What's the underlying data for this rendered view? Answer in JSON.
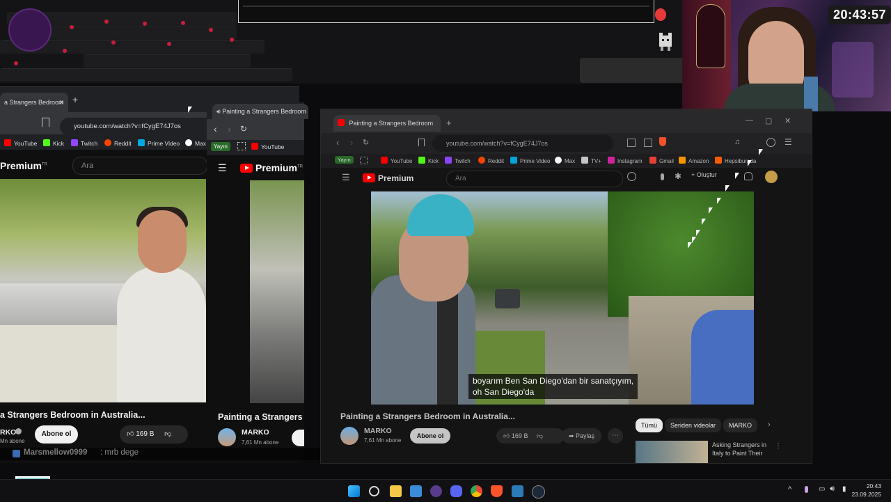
{
  "overlay": {
    "clock": "20:43:57",
    "chat_user": "Marsmellow0999",
    "chat_message": ": mrb dege"
  },
  "window_left": {
    "tab_title": "a Strangers Bedroom",
    "new_tab": "+",
    "url": "youtube.com/watch?v=fCygE74J7os",
    "bookmarks": [
      "YouTube",
      "Kick",
      "Twitch",
      "Reddit",
      "Prime Video",
      "Max"
    ],
    "logo": "Premium",
    "logo_sup": "TR",
    "search_placeholder": "Ara",
    "video_title": "a Strangers Bedroom in Australia...",
    "channel": "RKO",
    "subs": "Mn abone",
    "subscribe": "Abone ol",
    "likes": "169 B"
  },
  "window_middle": {
    "tab_title": "Painting a Strangers Bedroom",
    "badge": "Yayın",
    "bookmark": "YouTube",
    "logo": "Premium",
    "logo_sup": "TR",
    "video_title": "Painting a Strangers",
    "channel": "MARKO",
    "subs": "7,61 Mn abone"
  },
  "window_main": {
    "tab_title": "Painting a Strangers Bedroom",
    "url": "youtube.com/watch?v=fCygE74J7os",
    "badge": "Yayın",
    "bookmarks": [
      "YouTube",
      "Kick",
      "Twitch",
      "Reddit",
      "Prime Video",
      "Max",
      "TV+",
      "Instagram",
      "Gmail",
      "Amazon",
      "Hepsiburada"
    ],
    "logo": "Premium",
    "search_placeholder": "Ara",
    "create": "Oluştur",
    "caption_line1": "boyarım Ben San Diego'dan bir sanatçıyım,",
    "caption_line2": "oh San Diego'da",
    "video_title": "Painting a Strangers Bedroom in Australia...",
    "channel": "MARKO",
    "subs": "7,61 Mn abone",
    "subscribe": "Abone ol",
    "likes": "169 B",
    "share": "Paylaş",
    "more": "⋯",
    "chips": [
      "Tümü",
      "Seriden videolar",
      "MARKO"
    ],
    "rec_title_1": "Asking Strangers in",
    "rec_title_2": "Italy to Paint Their"
  },
  "taskbar": {
    "time": "20:43",
    "date": "23.09.2025"
  }
}
